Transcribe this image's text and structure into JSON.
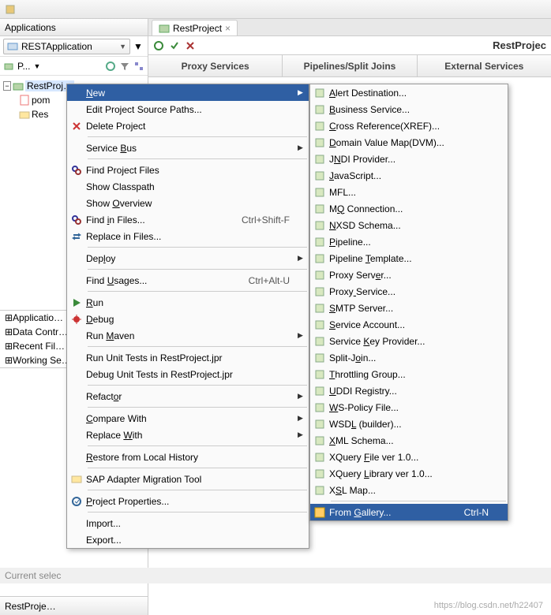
{
  "header_panel": "Applications",
  "app_combo": "RESTApplication",
  "proj_prefix": "P...",
  "tree": {
    "proj": "RestProj…",
    "pom": "pom",
    "res": "Res"
  },
  "mini_list": [
    "Applicatio…",
    "Data Contr…",
    "Recent Fil…",
    "Working Se…"
  ],
  "bottom_tab": "RestProje…",
  "editor_tab": "RestProject",
  "proj_label": "RestProjec",
  "svc_tabs": [
    "Proxy Services",
    "Pipelines/Split Joins",
    "External Services"
  ],
  "status": "Current selec",
  "watermark": "https://blog.csdn.net/h22407",
  "menu1": [
    {
      "label": "New",
      "u": 0,
      "arrow": true,
      "hilite": true
    },
    {
      "label": "Edit Project Source Paths..."
    },
    {
      "label": "Delete Project",
      "icon": "delete"
    },
    {
      "sep": true
    },
    {
      "label": "Service Bus",
      "u": 8,
      "arrow": true
    },
    {
      "sep": true
    },
    {
      "label": "Find Project Files",
      "icon": "find"
    },
    {
      "label": "Show Classpath"
    },
    {
      "label": "Show Overview",
      "u": 5
    },
    {
      "label": "Find in Files...",
      "u": 5,
      "icon": "findf",
      "shortcut": "Ctrl+Shift-F"
    },
    {
      "label": "Replace in Files...",
      "icon": "replace"
    },
    {
      "sep": true
    },
    {
      "label": "Deploy",
      "u": 3,
      "arrow": true
    },
    {
      "sep": true
    },
    {
      "label": "Find Usages...",
      "u": 5,
      "shortcut": "Ctrl+Alt-U"
    },
    {
      "sep": true
    },
    {
      "label": "Run",
      "u": 0,
      "icon": "run"
    },
    {
      "label": "Debug",
      "u": 0,
      "icon": "debug"
    },
    {
      "label": "Run Maven",
      "u": 4,
      "arrow": true
    },
    {
      "sep": true
    },
    {
      "label": "Run Unit Tests in RestProject.jpr"
    },
    {
      "label": "Debug Unit Tests in RestProject.jpr"
    },
    {
      "sep": true
    },
    {
      "label": "Refactor",
      "u": 6,
      "arrow": true
    },
    {
      "sep": true
    },
    {
      "label": "Compare With",
      "u": 0,
      "arrow": true
    },
    {
      "label": "Replace With",
      "u": 8,
      "arrow": true
    },
    {
      "sep": true
    },
    {
      "label": "Restore from Local History",
      "u": 0
    },
    {
      "sep": true
    },
    {
      "label": "SAP Adapter Migration Tool",
      "icon": "sap"
    },
    {
      "sep": true
    },
    {
      "label": "Project Properties...",
      "u": 0,
      "icon": "props"
    },
    {
      "sep": true
    },
    {
      "label": "Import..."
    },
    {
      "label": "Export..."
    }
  ],
  "menu2": [
    {
      "label": "Alert Destination...",
      "u": 0
    },
    {
      "label": "Business Service...",
      "u": 0
    },
    {
      "label": "Cross Reference(XREF)...",
      "u": 0
    },
    {
      "label": "Domain Value Map(DVM)...",
      "u": 0
    },
    {
      "label": "JNDI Provider...",
      "u": 1
    },
    {
      "label": "JavaScript...",
      "u": 0
    },
    {
      "label": "MFL..."
    },
    {
      "label": "MQ Connection...",
      "u": 1
    },
    {
      "label": "NXSD Schema...",
      "u": 0
    },
    {
      "label": "Pipeline...",
      "u": 0
    },
    {
      "label": "Pipeline Template...",
      "u": 9
    },
    {
      "label": "Proxy Server...",
      "u": 10
    },
    {
      "label": "Proxy Service...",
      "u": 5
    },
    {
      "label": "SMTP Server...",
      "u": 0
    },
    {
      "label": "Service Account...",
      "u": 0
    },
    {
      "label": "Service Key Provider...",
      "u": 8
    },
    {
      "label": "Split-Join...",
      "u": 7
    },
    {
      "label": "Throttling Group...",
      "u": 0
    },
    {
      "label": "UDDI Registry...",
      "u": 0
    },
    {
      "label": "WS-Policy File...",
      "u": 0
    },
    {
      "label": "WSDL (builder)...",
      "u": 3
    },
    {
      "label": "XML Schema...",
      "u": 0
    },
    {
      "label": "XQuery File ver 1.0...",
      "u": 7
    },
    {
      "label": "XQuery Library ver 1.0...",
      "u": 7
    },
    {
      "label": "XSL Map...",
      "u": 1
    },
    {
      "sep": true
    },
    {
      "label": "From Gallery...",
      "u": 5,
      "hilite": true,
      "shortcut": "Ctrl-N",
      "icon": "gallery"
    }
  ]
}
